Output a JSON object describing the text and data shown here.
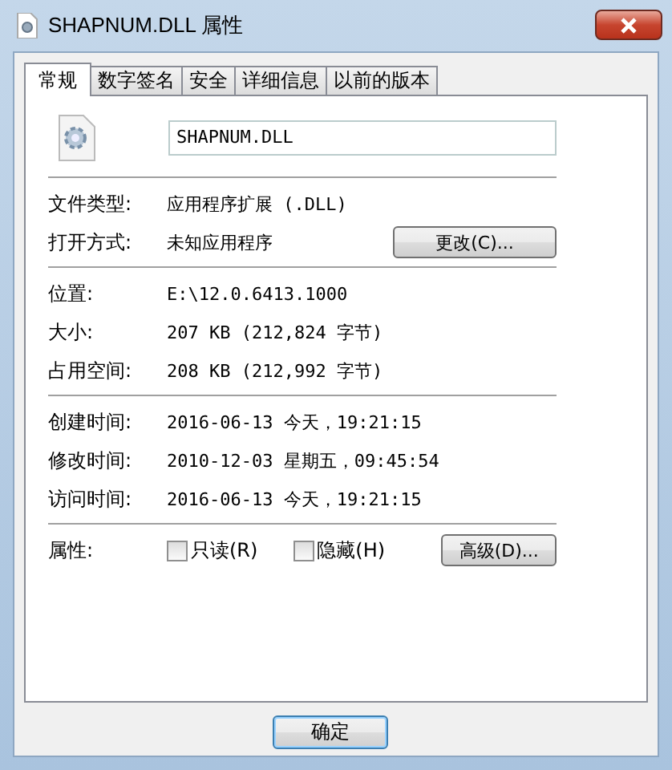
{
  "window": {
    "title": "SHAPNUM.DLL 属性"
  },
  "tabs": [
    {
      "label": "常规",
      "selected": true
    },
    {
      "label": "数字签名",
      "selected": false
    },
    {
      "label": "安全",
      "selected": false
    },
    {
      "label": "详细信息",
      "selected": false
    },
    {
      "label": "以前的版本",
      "selected": false
    }
  ],
  "file_name": "SHAPNUM.DLL",
  "sections": [
    {
      "rows": [
        {
          "label": "文件类型:",
          "value": "应用程序扩展 (.DLL)"
        },
        {
          "label": "打开方式:",
          "value": "未知应用程序",
          "button": "更改(C)..."
        }
      ]
    },
    {
      "rows": [
        {
          "label": "位置:",
          "value": "E:\\12.0.6413.1000"
        },
        {
          "label": "大小:",
          "value": "207 KB (212,824 字节)"
        },
        {
          "label": "占用空间:",
          "value": "208 KB (212,992 字节)"
        }
      ]
    },
    {
      "rows": [
        {
          "label": "创建时间:",
          "value": "2016-06-13 今天，19:21:15"
        },
        {
          "label": "修改时间:",
          "value": "2010-12-03 星期五，09:45:54"
        },
        {
          "label": "访问时间:",
          "value": "2016-06-13 今天，19:21:15"
        }
      ]
    }
  ],
  "attributes": {
    "label": "属性:",
    "checkboxes": [
      {
        "label": "只读(R)",
        "checked": false
      },
      {
        "label": "隐藏(H)",
        "checked": false
      }
    ],
    "button": "高级(D)..."
  },
  "buttons": [
    {
      "label": "确定",
      "default": true
    }
  ]
}
